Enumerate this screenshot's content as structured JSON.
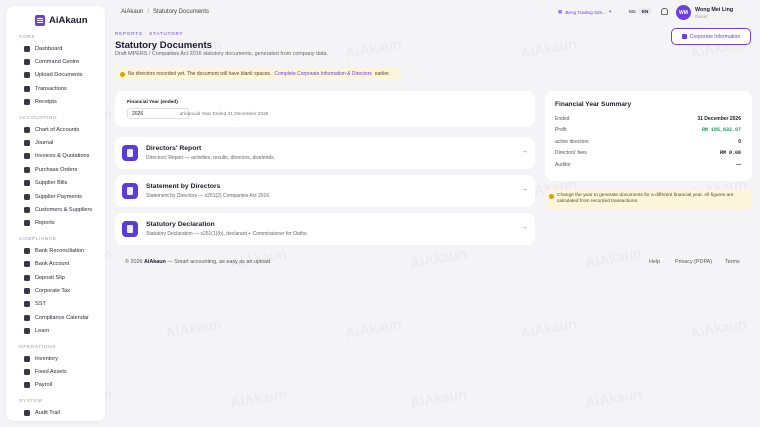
{
  "watermark": "AiAkaun",
  "brand": {
    "name": "AiAkaun"
  },
  "sidebar": {
    "sections": [
      {
        "label": "CORE",
        "items": [
          {
            "label": "Dashboard",
            "icon": "dashboard-icon"
          },
          {
            "label": "Command Centre",
            "icon": "command-icon"
          },
          {
            "label": "Upload Documents",
            "icon": "upload-icon"
          },
          {
            "label": "Transactions",
            "icon": "transactions-icon"
          },
          {
            "label": "Receipts",
            "icon": "receipt-icon"
          }
        ]
      },
      {
        "label": "ACCOUNTING",
        "items": [
          {
            "label": "Chart of Accounts",
            "icon": "chart-icon"
          },
          {
            "label": "Journal",
            "icon": "journal-icon"
          },
          {
            "label": "Invoices & Quotations",
            "icon": "invoice-icon"
          },
          {
            "label": "Purchase Orders",
            "icon": "cart-icon"
          },
          {
            "label": "Supplier Bills",
            "icon": "bill-icon"
          },
          {
            "label": "Supplier Payments",
            "icon": "payment-icon"
          },
          {
            "label": "Customers & Suppliers",
            "icon": "people-icon"
          },
          {
            "label": "Reports",
            "icon": "report-icon"
          }
        ]
      },
      {
        "label": "COMPLIANCE",
        "items": [
          {
            "label": "Bank Reconciliation",
            "icon": "check-icon"
          },
          {
            "label": "Bank Account",
            "icon": "bank-icon"
          },
          {
            "label": "Deposit Slip",
            "icon": "deposit-icon"
          },
          {
            "label": "Corporate Tax",
            "icon": "tax-icon"
          },
          {
            "label": "SST",
            "icon": "sst-icon"
          },
          {
            "label": "Compliance Calendar",
            "icon": "calendar-icon"
          },
          {
            "label": "Learn",
            "icon": "learn-icon"
          }
        ]
      },
      {
        "label": "OPERATIONS",
        "items": [
          {
            "label": "Inventory",
            "icon": "inventory-icon"
          },
          {
            "label": "Fixed Assets",
            "icon": "assets-icon"
          },
          {
            "label": "Payroll",
            "icon": "payroll-icon"
          }
        ]
      },
      {
        "label": "SYSTEM",
        "items": [
          {
            "label": "Audit Trail",
            "icon": "audit-icon"
          }
        ]
      }
    ]
  },
  "topbar": {
    "breadcrumb": [
      "AiAkaun",
      "Statutory Documents"
    ],
    "breadcrumb_sep": "/",
    "company": "Beng Trading Sdn...",
    "lang_ms": "MS",
    "lang_en": "EN",
    "avatar_initials": "WM",
    "user_name": "Wong Mei Ling",
    "user_role": "Owner"
  },
  "page": {
    "eyebrow": "REPORTS · STATUTORY",
    "title": "Statutory Documents",
    "subtitle": "Draft MPERS / Companies Act 2016 statutory documents, generated from company data.",
    "corp_button": "Corporate Information",
    "warning_text": "No directors recorded yet. The document will have blank spaces.",
    "warning_link": "Complete Corporate Information & Directors",
    "warning_tail": "earlier."
  },
  "fy": {
    "label": "Financial Year (ended)",
    "value": "2026",
    "ended": "Financial Year Ended 31 December 2026"
  },
  "documents": [
    {
      "title": "Directors' Report",
      "desc": "Directors' Report — activities, results, directors, dividends."
    },
    {
      "title": "Statement by Directors",
      "desc": "Statement by Directors — s251(2) Companies Act 2016"
    },
    {
      "title": "Statutory Declaration",
      "desc": "Statutory Declaration — s251(1)(b), declarant + Commissioner for Oaths."
    }
  ],
  "summary": {
    "title": "Financial Year Summary",
    "rows": [
      {
        "label": "Ended",
        "value": "31 December 2026"
      },
      {
        "label": "Profit",
        "value": "RM 185,632.07"
      },
      {
        "label": "active directors",
        "value": "0"
      },
      {
        "label": "Directors' fees",
        "value": "RM 0.00"
      },
      {
        "label": "Auditor",
        "value": "—"
      }
    ]
  },
  "note": "Change the year to generate documents for a different financial year. All figures are calculated from recorded transactions.",
  "footer": {
    "copyright_prefix": "© 2026",
    "brand": "AiAkaun",
    "tagline": "— Smart accounting, as easy as an upload.",
    "links": [
      "Help",
      "Privacy (PDPA)",
      "Terms"
    ]
  },
  "colors": {
    "accent": "#6d3fe0",
    "profit": "#1e9a5a",
    "warning_bg": "#fdf5dc"
  }
}
